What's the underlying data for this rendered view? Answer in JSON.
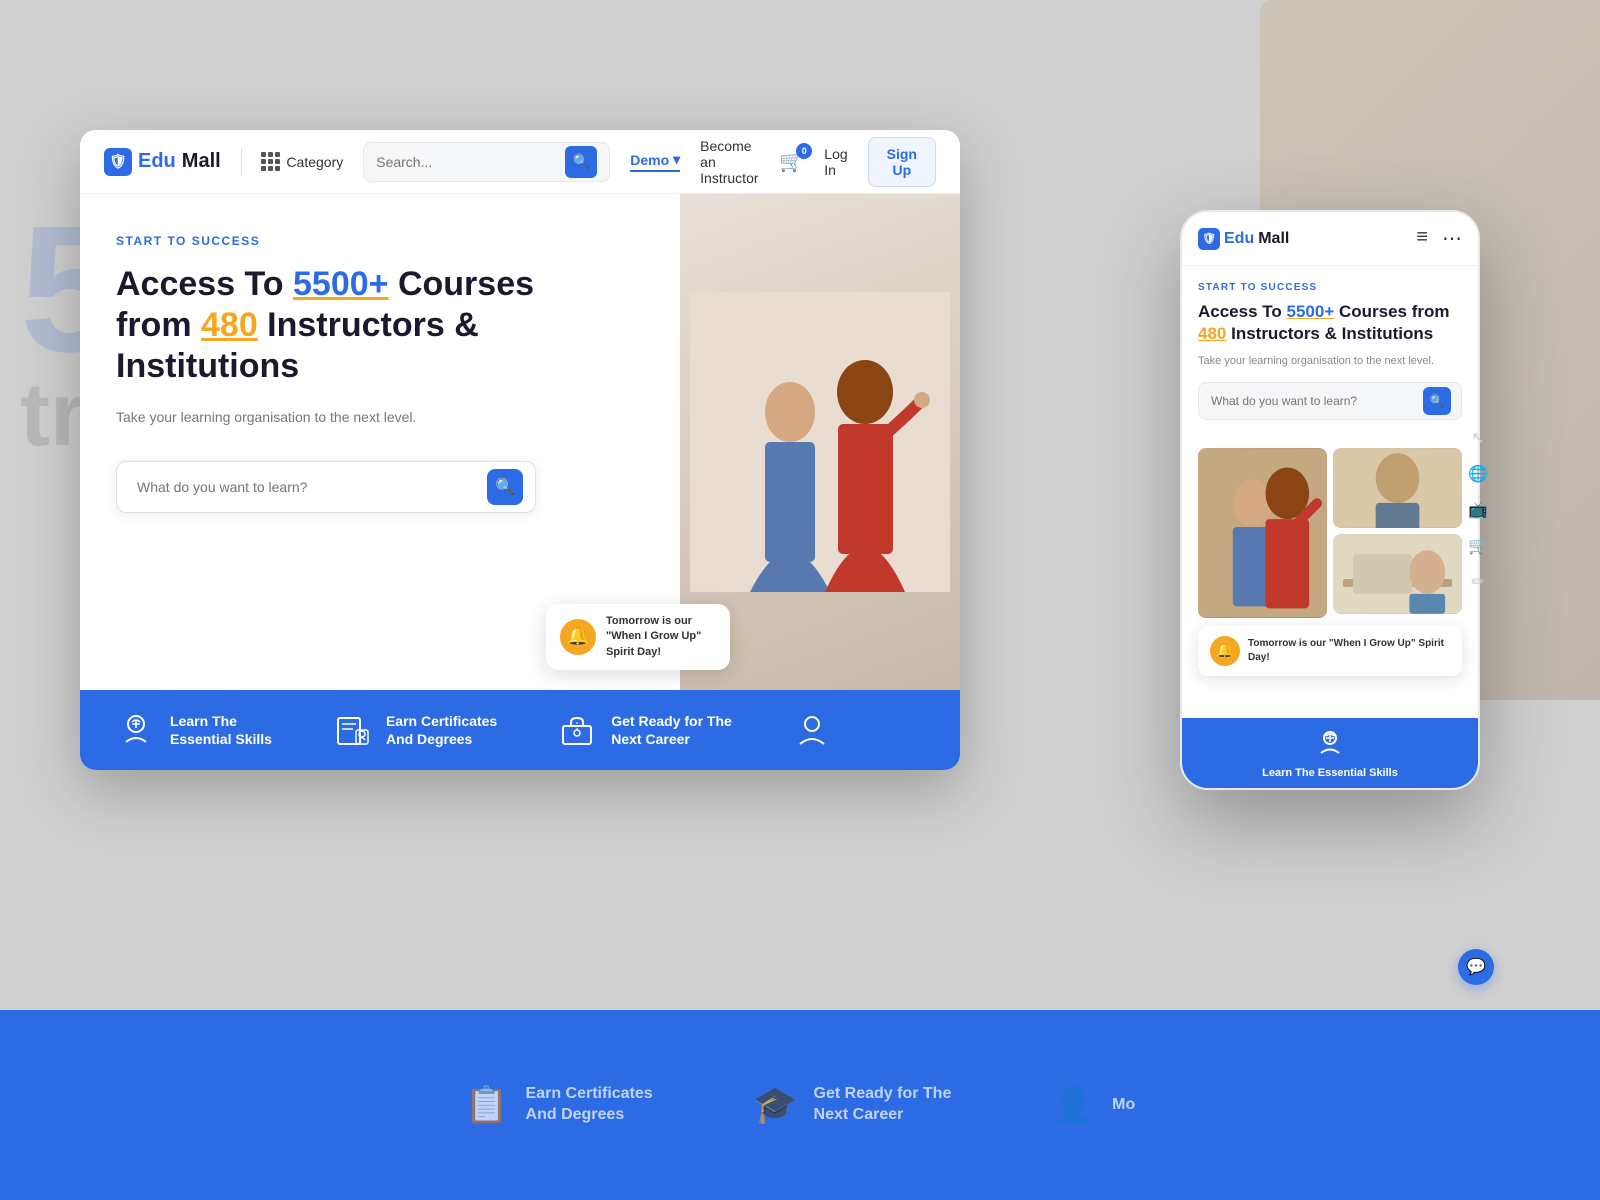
{
  "brand": {
    "name_part1": "Edu",
    "name_part2": "Mall",
    "logo_symbol": "🛡"
  },
  "nav": {
    "category_label": "Category",
    "search_placeholder": "Search...",
    "demo_label": "Demo",
    "instructor_label": "Become an Instructor",
    "cart_count": "0",
    "login_label": "Log In",
    "signup_label": "Sign Up"
  },
  "hero": {
    "subtitle": "START TO SUCCESS",
    "title_part1": "Access To ",
    "title_highlight1": "5500+",
    "title_part2": " Courses from ",
    "title_highlight2": "480",
    "title_part3": " Instructors & Institutions",
    "description": "Take your learning organisation to the next level.",
    "search_placeholder": "What do you want to learn?"
  },
  "notification": {
    "text": "Tomorrow is our \"When I Grow Up\" Spirit Day!"
  },
  "features": [
    {
      "id": "learn",
      "icon": "🧠",
      "line1": "Learn The",
      "line2": "Essential Skills"
    },
    {
      "id": "certificates",
      "icon": "📋",
      "line1": "Earn Certificates",
      "line2": "And Degrees"
    },
    {
      "id": "career",
      "icon": "🎓",
      "line1": "Get Ready for The",
      "line2": "Next Career"
    },
    {
      "id": "more",
      "icon": "👤",
      "line1": "",
      "line2": ""
    }
  ],
  "mobile": {
    "nav_menu": "≡",
    "nav_dots": "⋯",
    "hero_subtitle": "START TO SUCCESS",
    "hero_title_part1": "Access To ",
    "hero_title_highlight1": "5500+",
    "hero_title_part2": " Courses from ",
    "hero_title_highlight2": "480",
    "hero_title_part3": " Instructors & Institutions",
    "hero_desc": "Take your learning organisation to the next level.",
    "search_placeholder": "What do you want to learn?",
    "notification_text": "Tomorrow is our \"When I Grow Up\" Spirit Day!",
    "bottom_feature_line1": "Learn The Essential Skills"
  },
  "bottom_bar": {
    "features": [
      {
        "icon": "📋",
        "line1": "Earn Certificates",
        "line2": "And Degrees"
      },
      {
        "icon": "🎓",
        "line1": "Get Ready for The",
        "line2": "Next Career"
      },
      {
        "icon": "👤",
        "line1": "Mo",
        "line2": ""
      }
    ]
  },
  "colors": {
    "primary": "#2d6be4",
    "accent_yellow": "#f5a623",
    "dark": "#1a1a2e",
    "text_muted": "#777"
  },
  "scrollbar_icons": [
    "↕",
    "🌐",
    "📺",
    "🛒",
    "✏"
  ]
}
